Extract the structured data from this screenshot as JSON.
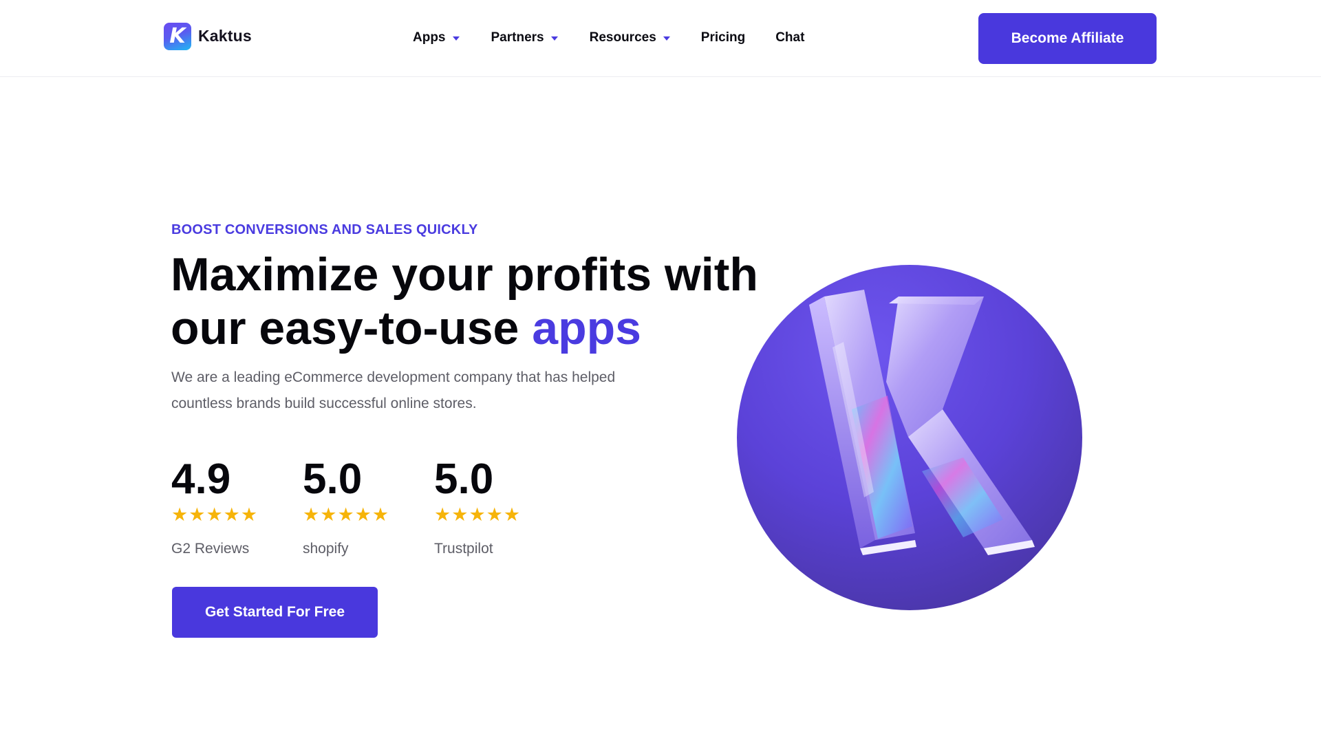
{
  "header": {
    "logo_text": "Kaktus",
    "logo_letter": "K",
    "nav": [
      {
        "label": "Apps",
        "has_dropdown": true
      },
      {
        "label": "Partners",
        "has_dropdown": true
      },
      {
        "label": "Resources",
        "has_dropdown": true
      },
      {
        "label": "Pricing",
        "has_dropdown": false
      },
      {
        "label": "Chat",
        "has_dropdown": false
      }
    ],
    "affiliate_label": "Become Affiliate"
  },
  "hero": {
    "eyebrow": "BOOST CONVERSIONS AND SALES QUICKLY",
    "title_main": "Maximize your profits with our easy-to-use ",
    "title_accent": "apps",
    "description": "We are a leading eCommerce development company that has helped countless brands build successful online stores.",
    "ratings": [
      {
        "score": "4.9",
        "source": "G2 Reviews",
        "stars": 5
      },
      {
        "score": "5.0",
        "source": "shopify",
        "stars": 5
      },
      {
        "score": "5.0",
        "source": "Trustpilot",
        "stars": 5
      }
    ],
    "cta_label": "Get Started For Free"
  },
  "icons": {
    "caret": "caret-down-icon",
    "star": "star-icon",
    "illustration": "kaktus-k-3d-logo"
  },
  "colors": {
    "brand": "#4938dd",
    "accent_text": "#4a3be0",
    "star": "#f6b40a",
    "circle": "#5a41d8"
  }
}
